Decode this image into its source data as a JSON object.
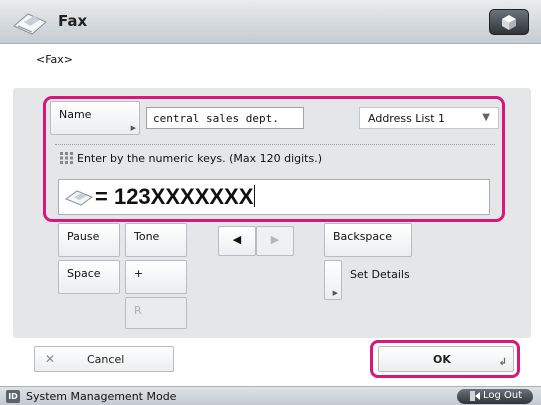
{
  "header": {
    "title": "Fax"
  },
  "subtitle": "<Fax>",
  "name_button": {
    "label": "Name"
  },
  "name_field": {
    "value": "central sales dept."
  },
  "address_list": {
    "selected": "Address List 1"
  },
  "hint": "Enter by the numeric keys. (Max 120 digits.)",
  "number_field": {
    "value": "= 123XXXXXXX"
  },
  "keys": {
    "pause": "Pause",
    "tone": "Tone",
    "space": "Space",
    "plus": "+",
    "r": "R",
    "left_arrow": "◀",
    "right_arrow": "▶",
    "backspace": "Backspace",
    "set_details": "Set Details"
  },
  "footer": {
    "cancel": "Cancel",
    "ok": "OK"
  },
  "statusbar": {
    "id_badge": "ID",
    "mode": "System Management Mode",
    "logout": "Log Out"
  },
  "colors": {
    "highlight": "#d8177e",
    "panel": "#e4e6e8"
  }
}
